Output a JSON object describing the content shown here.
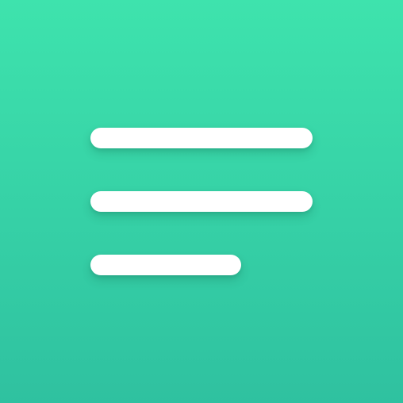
{
  "icon": {
    "name": "menu-lines-icon",
    "colors": {
      "gradient_top": "#3ee3ad",
      "gradient_bottom": "#2fc1a0",
      "line": "#ffffff"
    }
  }
}
